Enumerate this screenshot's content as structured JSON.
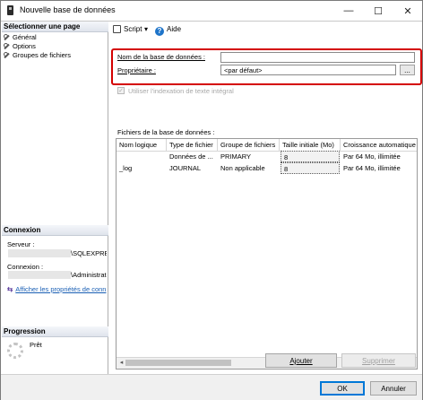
{
  "window": {
    "title": "Nouvelle base de données",
    "controls": {
      "minimize": "—",
      "maximize": "☐",
      "close": "✕"
    }
  },
  "sidebar": {
    "select_page_header": "Sélectionner une page",
    "pages": [
      {
        "label": "Général",
        "icon": "wrench-icon"
      },
      {
        "label": "Options",
        "icon": "wrench-icon"
      },
      {
        "label": "Groupes de fichiers",
        "icon": "wrench-icon"
      }
    ],
    "connection_header": "Connexion",
    "server_label": "Serveur :",
    "server_value": "\\SQLEXPRE",
    "connection_label": "Connexion :",
    "connection_value": "\\Administrat",
    "properties_link": "Afficher les propriétés de conn",
    "progress_header": "Progression",
    "progress_status": "Prêt"
  },
  "toolbar": {
    "script_label": "Script",
    "script_dropdown": "▾",
    "help_label": "Aide"
  },
  "form": {
    "db_name_label": "Nom de la base de données :",
    "db_name_value": "",
    "owner_label": "Propriétaire :",
    "owner_value": "<par défaut>",
    "owner_browse": "...",
    "fulltext_label": "Utiliser l'indexation de texte intégral",
    "fulltext_checked": true,
    "files_label": "Fichiers de la base de données :"
  },
  "files_grid": {
    "columns": [
      "Nom logique",
      "Type de fichier",
      "Groupe de fichiers",
      "Taille initiale (Mo)",
      "Croissance automatique"
    ],
    "rows": [
      [
        "",
        "Données de ...",
        "PRIMARY",
        "8",
        "Par 64 Mo, illimitée"
      ],
      [
        "_log",
        "JOURNAL",
        "Non applicable",
        "8",
        "Par 64 Mo, illimitée"
      ]
    ],
    "scroll_left": "◂",
    "scroll_right": "▸"
  },
  "grid_buttons": {
    "add": "Ajouter",
    "remove": "Supprimer"
  },
  "dialog_buttons": {
    "ok": "OK",
    "cancel": "Annuler"
  }
}
